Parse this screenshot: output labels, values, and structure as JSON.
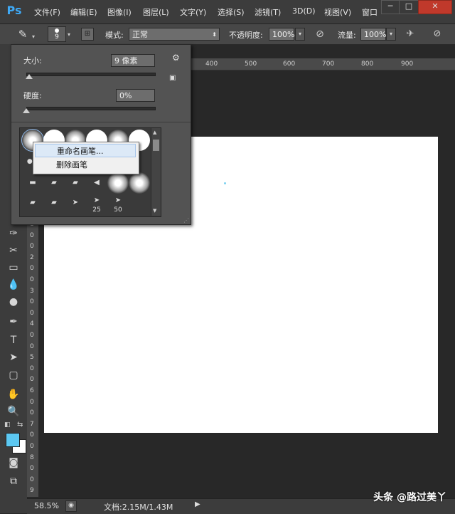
{
  "app": {
    "logo": "Ps",
    "menu": [
      "文件(F)",
      "编辑(E)",
      "图像(I)",
      "图层(L)",
      "文字(Y)",
      "选择(S)",
      "滤镜(T)",
      "3D(D)",
      "视图(V)",
      "窗口"
    ],
    "window_buttons": [
      "─",
      "□",
      "✕"
    ]
  },
  "options_bar": {
    "brush_size": "9",
    "mode_label": "模式:",
    "mode_value": "正常",
    "opacity_label": "不透明度:",
    "opacity_value": "100%",
    "flow_label": "流量:",
    "flow_value": "100%"
  },
  "ruler": {
    "h_ticks": [
      "400",
      "500",
      "600",
      "700",
      "800",
      "900"
    ],
    "v_ticks": [
      "1",
      "0",
      "0",
      "2",
      "0",
      "0",
      "3",
      "0",
      "0",
      "4",
      "0",
      "0",
      "5",
      "0",
      "0",
      "6",
      "0",
      "0",
      "7",
      "0",
      "0",
      "8",
      "0",
      "0",
      "9"
    ]
  },
  "brush_panel": {
    "size_label": "大小:",
    "size_value": "9 像素",
    "size_level": 0.02,
    "hardness_label": "硬度:",
    "hardness_value": "0%",
    "hardness_level": 0.0,
    "brush_numbers": [
      "25",
      "50"
    ]
  },
  "context_menu": {
    "items": [
      "重命名画笔...",
      "删除画笔"
    ]
  },
  "status": {
    "zoom": "58.5%",
    "doc": "文档:2.15M/1.43M"
  },
  "colors": {
    "foreground": "#5cc8f2",
    "background": "#ffffff",
    "accent": "#3fa9f5"
  },
  "watermark": "头条 @路过美丫"
}
